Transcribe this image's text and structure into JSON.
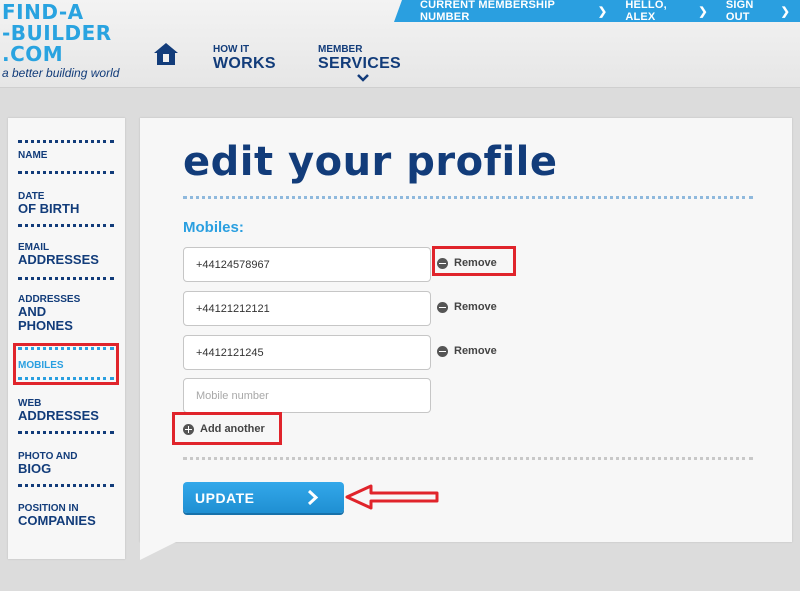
{
  "header": {
    "logo": {
      "line1": "FIND-A",
      "line2": "-BUILDER",
      "line3": ".COM",
      "tagline": "a better building world"
    },
    "nav": [
      {
        "small": "HOW IT",
        "big": "WORKS"
      },
      {
        "small": "MEMBER",
        "big": "SERVICES"
      }
    ],
    "topbar": {
      "membership": "CURRENT MEMBERSHIP NUMBER",
      "greeting": "HELLO, ALEX",
      "signout": "SIGN OUT"
    }
  },
  "sidebar": {
    "items": [
      {
        "small": "",
        "big": "NAME"
      },
      {
        "small": "DATE",
        "big": "OF BIRTH"
      },
      {
        "small": "EMAIL",
        "big": "ADDRESSES"
      },
      {
        "small": "ADDRESSES",
        "big": "AND PHONES"
      },
      {
        "small": "MOBILES",
        "big": ""
      },
      {
        "small": "WEB",
        "big": "ADDRESSES"
      },
      {
        "small": "PHOTO AND",
        "big": "BIOG"
      },
      {
        "small": "POSITION IN",
        "big": "COMPANIES"
      }
    ],
    "active_index": 4
  },
  "main": {
    "title": "edit your profile",
    "section_label": "Mobiles:",
    "mobiles": [
      {
        "value": "+44124578967",
        "remove_label": "Remove"
      },
      {
        "value": "+44121212121",
        "remove_label": "Remove"
      },
      {
        "value": "+4412121245",
        "remove_label": "Remove"
      }
    ],
    "new_mobile_placeholder": "Mobile number",
    "add_label": "Add another",
    "update_label": "UPDATE"
  },
  "colors": {
    "brand_blue": "#2a9fe0",
    "navy": "#123c7a",
    "annotation_red": "#e0242b"
  },
  "icons": [
    "home-icon",
    "chevron-right-icon",
    "chevron-down-icon",
    "minus-circle-icon",
    "plus-circle-icon"
  ]
}
